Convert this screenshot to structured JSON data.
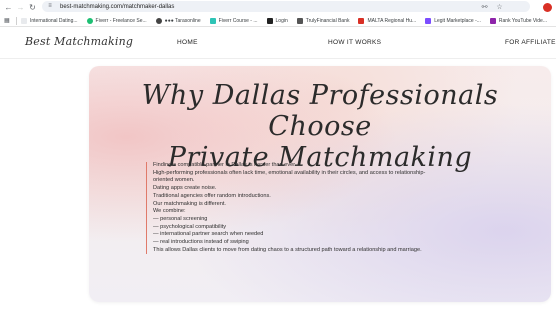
{
  "browser": {
    "url": "best-matchmaking.com/matchmaker-dallas",
    "bookmarks": [
      {
        "label": "International Dating...",
        "color": "#e8eaed"
      },
      {
        "label": "Fiverr - Freelance Se...",
        "color": "#1dbf73"
      },
      {
        "label": "●●● Tarasonline",
        "color": "#444444"
      },
      {
        "label": "Fiverr Course - ...",
        "color": "#2ec4b6"
      },
      {
        "label": "Login",
        "color": "#222222"
      },
      {
        "label": "TrulyFinancial Bank",
        "color": "#555555"
      },
      {
        "label": "MALTA Regional Hu...",
        "color": "#d93025"
      },
      {
        "label": "Legit Marketplace -...",
        "color": "#7c4dff"
      },
      {
        "label": "Rank YouTube Vide...",
        "color": "#8e24aa"
      }
    ]
  },
  "site": {
    "logo": "Best Matchmaking",
    "menu": {
      "home": "HOME",
      "how": "HOW IT WORKS",
      "affiliate": "FOR AFFILIATE"
    }
  },
  "hero": {
    "title_line1": "Why Dallas Professionals Choose",
    "title_line2": "Private Matchmaking",
    "lines": [
      "Finding a compatible partner in Dallas is harder than ever.",
      "High-performing professionals often lack time, emotional availability in their circles, and access to relationship-",
      "oriented women.",
      "Dating apps create noise.",
      "Traditional agencies offer random introductions.",
      "Our matchmaking is different.",
      "We combine:",
      "— personal screening",
      "— psychological compatibility",
      "— international partner search when needed",
      "— real introductions instead of swiping",
      "This allows Dallas clients to move from dating chaos to a structured path toward a relationship and marriage."
    ]
  },
  "colors": {
    "accent_border": "#e07a6a",
    "card_background": "#f5eded"
  }
}
